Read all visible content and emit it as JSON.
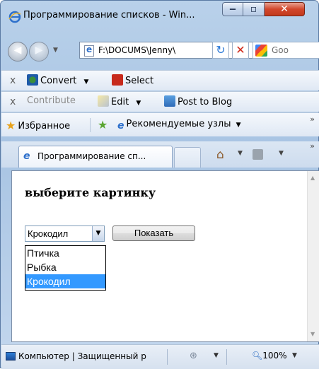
{
  "window": {
    "title": "Программирование списков - Win...",
    "caption_buttons": {
      "minimize": "‒",
      "maximize": "▫",
      "close": "✕"
    }
  },
  "address_bar": {
    "url": "F:\\DOCUMS\\Jenny\\",
    "search_text": "Goo"
  },
  "toolbar1": {
    "close": "x",
    "convert_label": "Convert",
    "select_label": "Select"
  },
  "toolbar2": {
    "close": "x",
    "contribute_label": "Contribute",
    "edit_label": "Edit",
    "post_label": "Post to Blog"
  },
  "favorites_bar": {
    "favorites_label": "Избранное",
    "suggested_label": "Рекомендуемые узлы",
    "more": "»"
  },
  "tabs": {
    "active_label": "Программирование сп...",
    "more": "»"
  },
  "content": {
    "heading": "выберите картинку",
    "select_value": "Крокодил",
    "button_label": "Показать",
    "options": [
      {
        "label": "Птичка",
        "selected": false
      },
      {
        "label": "Рыбка",
        "selected": false
      },
      {
        "label": "Крокодил",
        "selected": true
      }
    ]
  },
  "status_bar": {
    "zone_text": "Компьютер | Защищенный р",
    "zoom": "100%"
  },
  "colors": {
    "selection": "#3399ff",
    "close_button": "#d2472c"
  }
}
